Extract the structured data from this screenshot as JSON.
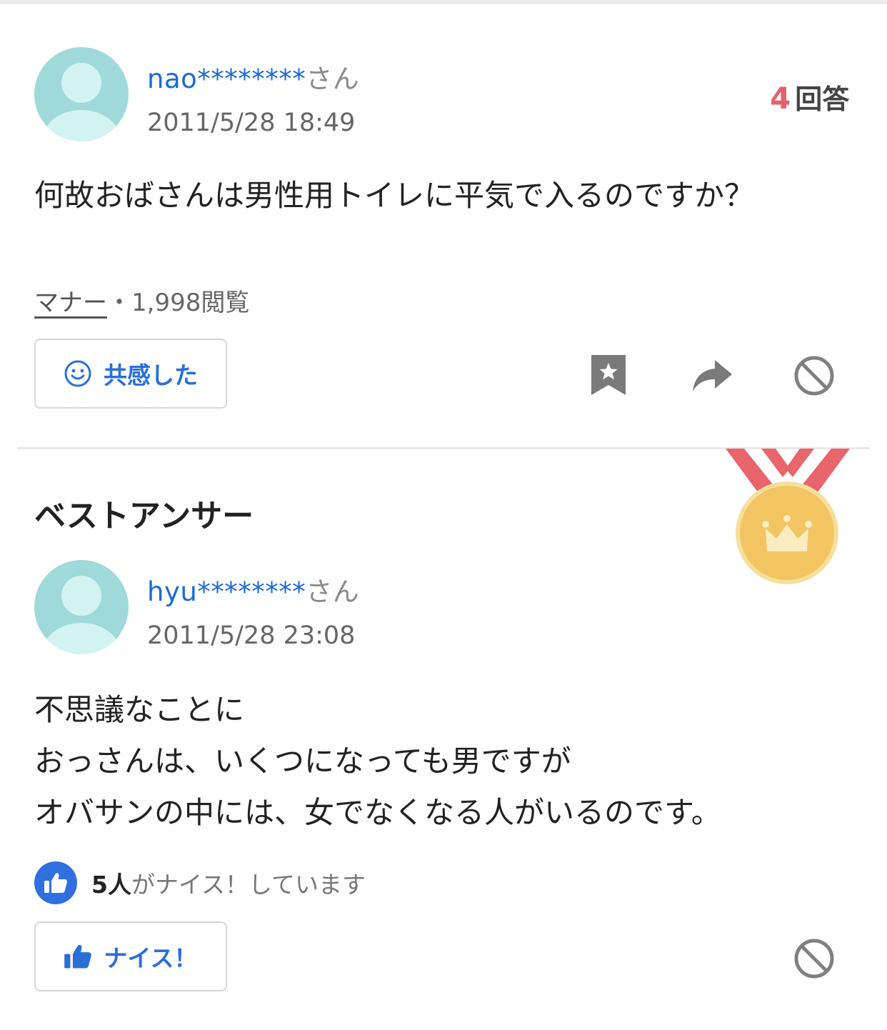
{
  "question": {
    "user_name": "nao********",
    "user_suffix": "さん",
    "timestamp": "2011/5/28 18:49",
    "answer_count": "4",
    "answer_unit": "回答",
    "text": "何故おばさんは男性用トイレに平気で入るのですか？",
    "category": "マナー",
    "views": "・1,998閲覧",
    "empathy_label": "共感した",
    "icons": [
      "smiley-icon",
      "bookmark-star-icon",
      "share-arrow-icon",
      "block-icon"
    ]
  },
  "best_answer": {
    "heading": "ベストアンサー",
    "user_name": "hyu********",
    "user_suffix": "さん",
    "timestamp": "2011/5/28 23:08",
    "lines": [
      "不思議なことに",
      "おっさんは、いくつになっても男ですが",
      "オバサンの中には、女でなくなる人がいるのです。"
    ],
    "nice_count": "5人",
    "nice_text": "がナイス！しています",
    "nice_label": "ナイス！",
    "icons": [
      "medal-crown-icon",
      "thumbs-up-icon",
      "block-icon"
    ]
  },
  "colors": {
    "link_blue": "#1c6ad6",
    "button_blue": "#2a6fd8",
    "answer_count_red": "#e8606a",
    "medal_gold": "#f2c462",
    "ribbon_red": "#e8656b",
    "avatar_teal": "#9fd9d9"
  }
}
